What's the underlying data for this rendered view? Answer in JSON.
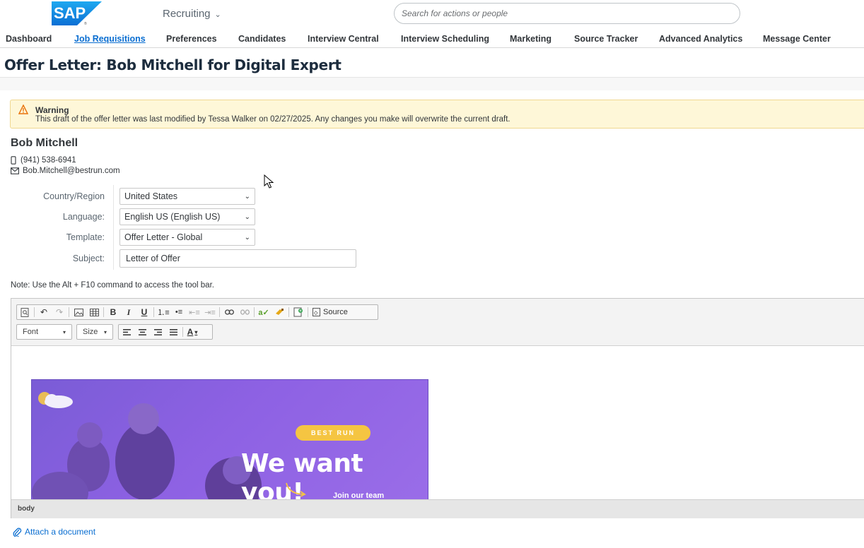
{
  "shell": {
    "logo_text": "SAP",
    "app_name": "Recruiting",
    "search_placeholder": "Search for actions or people"
  },
  "nav_tabs": [
    {
      "label": "Dashboard"
    },
    {
      "label": "Job Requisitions",
      "active": true
    },
    {
      "label": "Preferences"
    },
    {
      "label": "Candidates"
    },
    {
      "label": "Interview Central"
    },
    {
      "label": "Interview Scheduling"
    },
    {
      "label": "Marketing"
    },
    {
      "label": "Source Tracker"
    },
    {
      "label": "Advanced Analytics"
    },
    {
      "label": "Message Center"
    }
  ],
  "page_title": "Offer Letter: Bob Mitchell for Digital Expert",
  "warning": {
    "title": "Warning",
    "text": "This draft of the offer letter was last modified by Tessa Walker on 02/27/2025. Any changes you make will overwrite the current draft."
  },
  "candidate": {
    "name": "Bob Mitchell",
    "phone": "(941) 538-6941",
    "email": "Bob.Mitchell@bestrun.com"
  },
  "form": {
    "country_label": "Country/Region",
    "country_value": "United States",
    "language_label": "Language:",
    "language_value": "English US (English US)",
    "template_label": "Template:",
    "template_value": "Offer Letter - Global",
    "subject_label": "Subject:",
    "subject_value": "Letter of Offer"
  },
  "note": "Note: Use the Alt + F10 command to access the tool bar.",
  "editor": {
    "source_label": "Source",
    "font_label": "Font",
    "size_label": "Size",
    "status_path": "body",
    "banner": {
      "pill": "BEST RUN",
      "headline": "We want you!",
      "subline": "Join our team"
    }
  },
  "attach_label": "Attach a document",
  "colors": {
    "brand_blue": "#0a6ed1",
    "warning_bg": "#fef7d8",
    "banner_purple": "#8d61e3",
    "pill_yellow": "#f5c542"
  }
}
